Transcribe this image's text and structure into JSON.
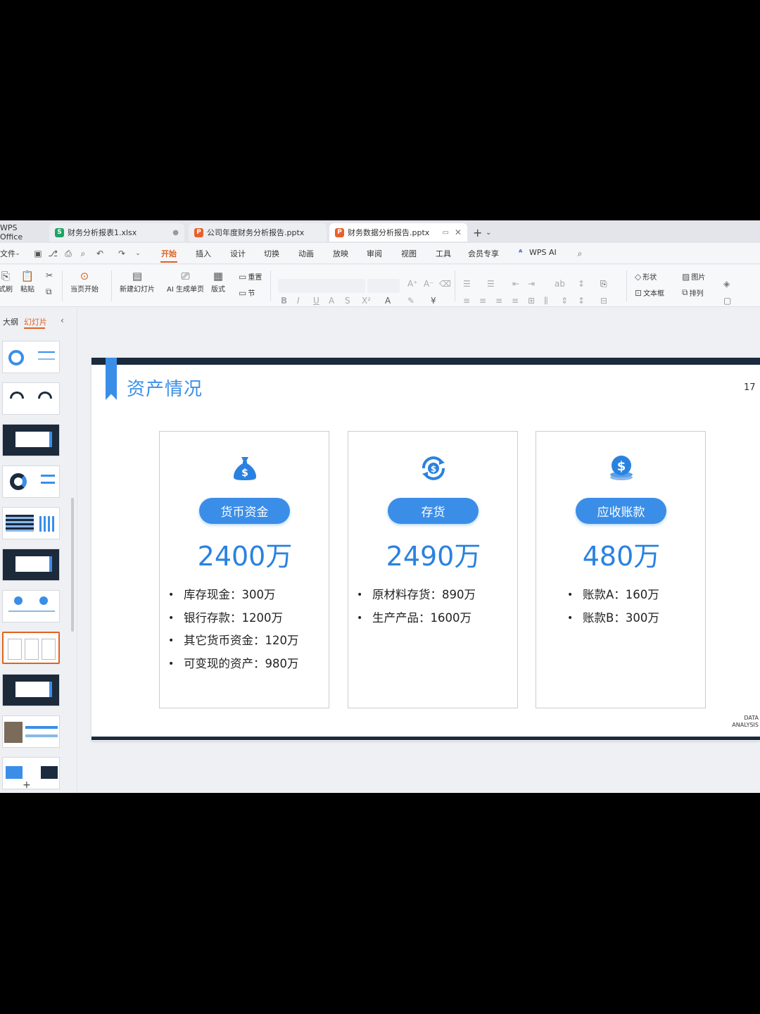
{
  "tabs": {
    "home": "WPS Office",
    "items": [
      {
        "badge": "S",
        "label": "财务分析报表1.xlsx"
      },
      {
        "badge": "P",
        "label": "公司年度财务分析报告.pptx"
      },
      {
        "badge": "P",
        "label": "财务数据分析报告.pptx"
      }
    ]
  },
  "menu": {
    "file": "文件",
    "items": [
      "开始",
      "插入",
      "设计",
      "切换",
      "动画",
      "放映",
      "审阅",
      "视图",
      "工具",
      "会员专享"
    ],
    "active": "开始",
    "ai": "WPS AI"
  },
  "ribbon": {
    "format_painter": "式刷",
    "paste": "粘贴",
    "play_current": "当页开始",
    "new_slide": "新建幻灯片",
    "ai_page": "AI 生成单页",
    "layout": "版式",
    "reset": "重置",
    "section": "节",
    "shape": "形状",
    "picture": "图片",
    "textbox": "文本框",
    "arrange": "排列"
  },
  "left_panel": {
    "outline_tab": "大纲",
    "slides_tab": "幻灯片",
    "selected_index": 7
  },
  "slide": {
    "title": "资产情况",
    "page_number": "17",
    "footer_line1": "DATA",
    "footer_line2": "ANALYSIS",
    "cards": [
      {
        "icon": "money-bag-icon",
        "label": "货币资金",
        "amount": "2400万",
        "items": [
          "库存现金：300万",
          "银行存款：1200万",
          "其它货币资金：120万",
          "可变现的资产：980万"
        ]
      },
      {
        "icon": "cycle-dollar-icon",
        "label": "存货",
        "amount": "2490万",
        "items": [
          "原材料存货：890万",
          "生产产品：1600万"
        ]
      },
      {
        "icon": "coin-stack-icon",
        "label": "应收账款",
        "amount": "480万",
        "items": [
          "账款A：160万",
          "账款B：300万"
        ]
      }
    ]
  },
  "colors": {
    "accent_blue": "#3a8ee8",
    "active_orange": "#e0621f",
    "slide_bar": "#1b2a3d"
  }
}
